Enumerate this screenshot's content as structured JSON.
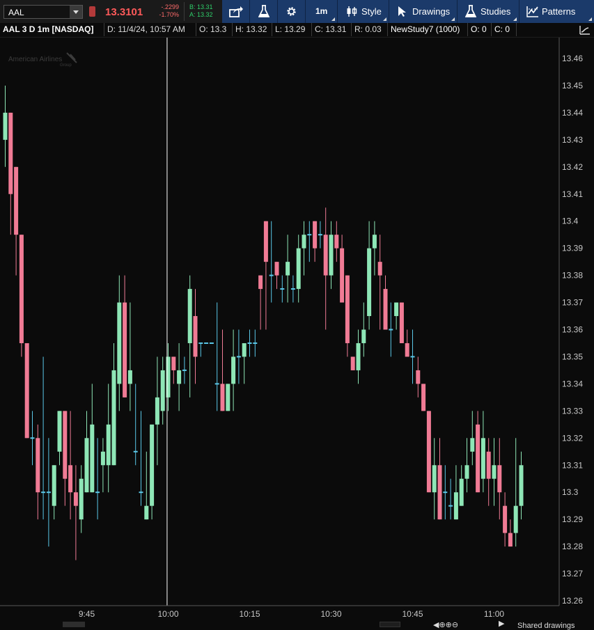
{
  "toolbar": {
    "symbol": "AAL",
    "last_price": "13.3101",
    "net_change": "-.2299",
    "pct_change": "-1.70%",
    "bid": "B: 13.31",
    "ask": "A: 13.32",
    "interval": "1m",
    "style_label": "Style",
    "drawings_label": "Drawings",
    "studies_label": "Studies",
    "patterns_label": "Patterns"
  },
  "infobar": {
    "title": "AAL 3 D 1m [NASDAQ]",
    "date": "D: 11/4/24, 10:57 AM",
    "open": "O: 13.3",
    "high": "H: 13.32",
    "low": "L: 13.29",
    "close": "C: 13.31",
    "range": "R: 0.03",
    "study": "NewStudy7 (1000)",
    "study_o": "O: 0",
    "study_c": "C: 0"
  },
  "watermark": {
    "line1": "American Airlines",
    "line2": "Group"
  },
  "bottom": {
    "shared": "Shared drawings"
  },
  "chart_data": {
    "type": "candlestick",
    "title": "",
    "xlabel": "",
    "ylabel": "",
    "ylim": [
      13.255,
      13.465
    ],
    "y_ticks": [
      13.26,
      13.27,
      13.28,
      13.29,
      13.3,
      13.31,
      13.32,
      13.33,
      13.34,
      13.35,
      13.36,
      13.37,
      13.38,
      13.39,
      13.4,
      13.41,
      13.42,
      13.43,
      13.44,
      13.45,
      13.46
    ],
    "x_ticks": [
      "9:45",
      "10:00",
      "10:15",
      "10:30",
      "10:45",
      "11:00"
    ],
    "x_tick_minutes": [
      15,
      30,
      45,
      60,
      75,
      90
    ],
    "crosshair_minute": 29.8,
    "colors": {
      "up": "#8ee6b6",
      "down": "#f07b95",
      "doji": "#5bc8e8",
      "crosshair": "#ffffff",
      "axis_text": "#c8c8c8"
    },
    "candles": [
      [
        13.43,
        13.45,
        13.42,
        13.44
      ],
      [
        13.44,
        13.44,
        13.395,
        13.41
      ],
      [
        13.42,
        13.42,
        13.38,
        13.395
      ],
      [
        13.395,
        13.395,
        13.35,
        13.355
      ],
      [
        13.355,
        13.355,
        13.32,
        13.32
      ],
      [
        13.32,
        13.33,
        13.31,
        13.32
      ],
      [
        13.32,
        13.325,
        13.29,
        13.3
      ],
      [
        13.3,
        13.35,
        13.29,
        13.3
      ],
      [
        13.3,
        13.32,
        13.28,
        13.3
      ],
      [
        13.295,
        13.31,
        13.29,
        13.31
      ],
      [
        13.315,
        13.33,
        13.31,
        13.33
      ],
      [
        13.33,
        13.33,
        13.295,
        13.305
      ],
      [
        13.31,
        13.33,
        13.29,
        13.3
      ],
      [
        13.3,
        13.31,
        13.275,
        13.295
      ],
      [
        13.29,
        13.31,
        13.285,
        13.305
      ],
      [
        13.3,
        13.33,
        13.3,
        13.32
      ],
      [
        13.3,
        13.34,
        13.3,
        13.325
      ],
      [
        13.3,
        13.32,
        13.29,
        13.3
      ],
      [
        13.31,
        13.32,
        13.3,
        13.315
      ],
      [
        13.31,
        13.34,
        13.3,
        13.325
      ],
      [
        13.31,
        13.355,
        13.31,
        13.345
      ],
      [
        13.34,
        13.38,
        13.33,
        13.37
      ],
      [
        13.37,
        13.38,
        13.335,
        13.335
      ],
      [
        13.34,
        13.37,
        13.33,
        13.345
      ],
      [
        13.315,
        13.34,
        13.31,
        13.315
      ],
      [
        13.3,
        13.33,
        13.295,
        13.3
      ],
      [
        13.29,
        13.315,
        13.29,
        13.295
      ],
      [
        13.295,
        13.32,
        13.29,
        13.325
      ],
      [
        13.325,
        13.35,
        13.31,
        13.335
      ],
      [
        13.33,
        13.35,
        13.325,
        13.345
      ],
      [
        13.335,
        13.355,
        13.33,
        13.35
      ],
      [
        13.35,
        13.35,
        13.34,
        13.345
      ],
      [
        13.34,
        13.355,
        13.33,
        13.345
      ],
      [
        13.345,
        13.35,
        13.34,
        13.345
      ],
      [
        13.355,
        13.38,
        13.335,
        13.375
      ],
      [
        13.365,
        13.375,
        13.34,
        13.35
      ],
      [
        13.355,
        13.355,
        13.35,
        13.355
      ],
      [
        13.355,
        13.355,
        13.355,
        13.355
      ],
      [
        13.355,
        13.35,
        13.35,
        13.355
      ],
      [
        13.34,
        13.37,
        13.33,
        13.34
      ],
      [
        13.34,
        13.36,
        13.33,
        13.33
      ],
      [
        13.33,
        13.34,
        13.33,
        13.34
      ],
      [
        13.34,
        13.36,
        13.33,
        13.35
      ],
      [
        13.35,
        13.36,
        13.34,
        13.35
      ],
      [
        13.35,
        13.355,
        13.34,
        13.355
      ],
      [
        13.355,
        13.36,
        13.35,
        13.355
      ],
      [
        13.355,
        13.36,
        13.35,
        13.355
      ],
      [
        13.38,
        13.38,
        13.36,
        13.375
      ],
      [
        13.4,
        13.4,
        13.36,
        13.385
      ],
      [
        13.38,
        13.4,
        13.37,
        13.38
      ],
      [
        13.385,
        13.385,
        13.375,
        13.38
      ],
      [
        13.375,
        13.38,
        13.37,
        13.375
      ],
      [
        13.38,
        13.395,
        13.37,
        13.385
      ],
      [
        13.375,
        13.38,
        13.37,
        13.375
      ],
      [
        13.375,
        13.395,
        13.37,
        13.39
      ],
      [
        13.39,
        13.4,
        13.38,
        13.395
      ],
      [
        13.395,
        13.4,
        13.385,
        13.395
      ],
      [
        13.4,
        13.4,
        13.385,
        13.39
      ],
      [
        13.395,
        13.4,
        13.39,
        13.395
      ],
      [
        13.395,
        13.405,
        13.36,
        13.38
      ],
      [
        13.38,
        13.4,
        13.375,
        13.395
      ],
      [
        13.395,
        13.4,
        13.385,
        13.39
      ],
      [
        13.39,
        13.395,
        13.37,
        13.37
      ],
      [
        13.38,
        13.38,
        13.35,
        13.355
      ],
      [
        13.35,
        13.35,
        13.345,
        13.345
      ],
      [
        13.345,
        13.36,
        13.34,
        13.355
      ],
      [
        13.355,
        13.37,
        13.35,
        13.36
      ],
      [
        13.365,
        13.4,
        13.36,
        13.39
      ],
      [
        13.39,
        13.4,
        13.38,
        13.395
      ],
      [
        13.385,
        13.395,
        13.36,
        13.38
      ],
      [
        13.375,
        13.38,
        13.36,
        13.36
      ],
      [
        13.36,
        13.37,
        13.35,
        13.36
      ],
      [
        13.365,
        13.37,
        13.36,
        13.37
      ],
      [
        13.37,
        13.37,
        13.355,
        13.355
      ],
      [
        13.355,
        13.36,
        13.35,
        13.35
      ],
      [
        13.35,
        13.36,
        13.34,
        13.35
      ],
      [
        13.345,
        13.35,
        13.335,
        13.34
      ],
      [
        13.34,
        13.34,
        13.33,
        13.33
      ],
      [
        13.33,
        13.33,
        13.3,
        13.3
      ],
      [
        13.3,
        13.32,
        13.29,
        13.31
      ],
      [
        13.31,
        13.32,
        13.29,
        13.29
      ],
      [
        13.3,
        13.31,
        13.29,
        13.3
      ],
      [
        13.295,
        13.305,
        13.29,
        13.295
      ],
      [
        13.29,
        13.31,
        13.29,
        13.3
      ],
      [
        13.295,
        13.31,
        13.295,
        13.305
      ],
      [
        13.305,
        13.32,
        13.3,
        13.31
      ],
      [
        13.315,
        13.33,
        13.31,
        13.32
      ],
      [
        13.325,
        13.33,
        13.3,
        13.3
      ],
      [
        13.305,
        13.33,
        13.3,
        13.32
      ],
      [
        13.315,
        13.32,
        13.295,
        13.305
      ],
      [
        13.305,
        13.32,
        13.295,
        13.31
      ],
      [
        13.31,
        13.32,
        13.29,
        13.3
      ],
      [
        13.295,
        13.3,
        13.28,
        13.285
      ],
      [
        13.285,
        13.29,
        13.28,
        13.28
      ],
      [
        13.285,
        13.32,
        13.28,
        13.295
      ],
      [
        13.295,
        13.315,
        13.29,
        13.31
      ]
    ]
  }
}
